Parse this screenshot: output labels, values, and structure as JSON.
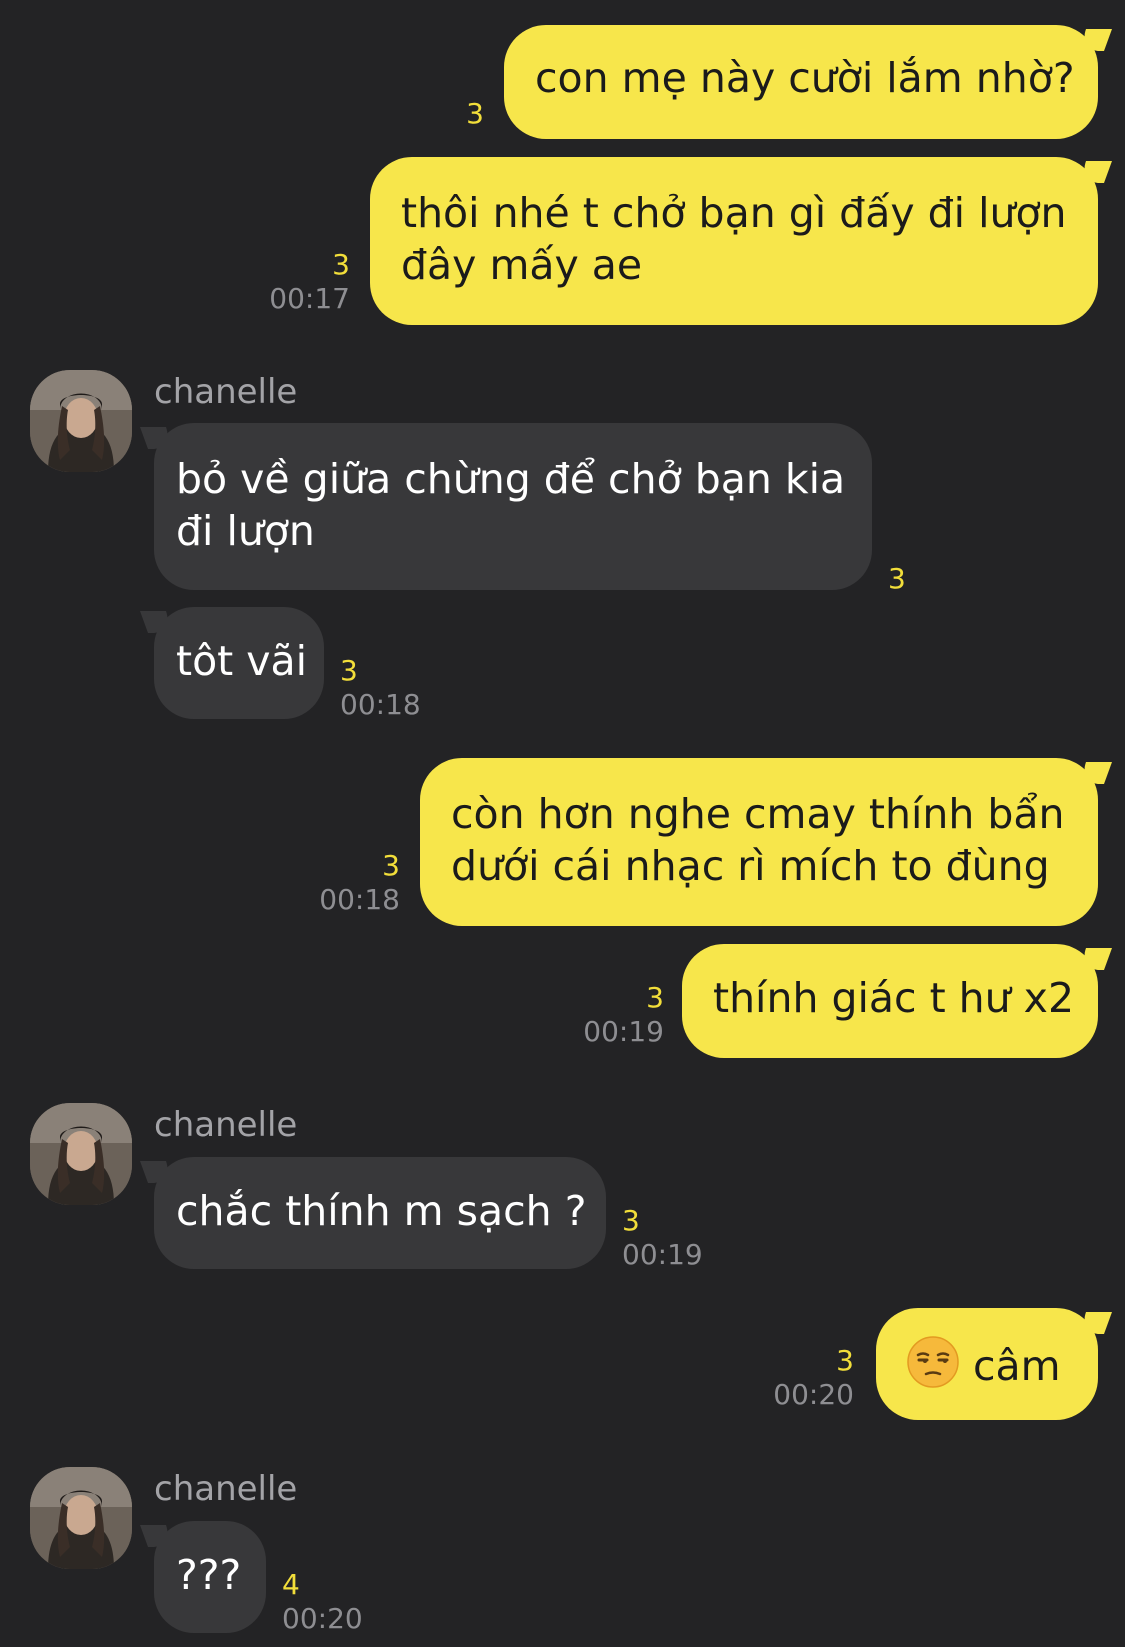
{
  "colors": {
    "background": "#232325",
    "my_bubble": "#F7E64B",
    "their_bubble": "#38383A",
    "read_count": "#F2DE3A",
    "timestamp": "#8e8e92"
  },
  "messages": [
    {
      "from": "me",
      "lines": [
        "con mẹ này cười lắm nhờ?"
      ],
      "count": "3",
      "time": ""
    },
    {
      "from": "me",
      "lines": [
        "thôi nhé t chở bạn gì đấy đi lượn",
        "đây mấy ae"
      ],
      "count": "3",
      "time": "00:17"
    },
    {
      "from": "them",
      "sender": "chanelle",
      "lines": [
        "bỏ về giữa chừng để chở bạn kia",
        "đi lượn"
      ],
      "count": "3",
      "time": ""
    },
    {
      "from": "them",
      "lines": [
        "tôt vãi"
      ],
      "count": "3",
      "time": "00:18"
    },
    {
      "from": "me",
      "lines": [
        "còn hơn nghe cmay thính bẩn",
        "dưới cái nhạc rì mích to đùng"
      ],
      "count": "3",
      "time": "00:18"
    },
    {
      "from": "me",
      "lines": [
        "thính giác t hư x2"
      ],
      "count": "3",
      "time": "00:19"
    },
    {
      "from": "them",
      "sender": "chanelle",
      "lines": [
        "chắc thính m sạch ?"
      ],
      "count": "3",
      "time": "00:19"
    },
    {
      "from": "me",
      "emoji": "unamused-face-emoji",
      "lines": [
        "câm"
      ],
      "count": "3",
      "time": "00:20"
    },
    {
      "from": "them",
      "sender": "chanelle",
      "lines": [
        "???"
      ],
      "count": "4",
      "time": "00:20"
    }
  ]
}
